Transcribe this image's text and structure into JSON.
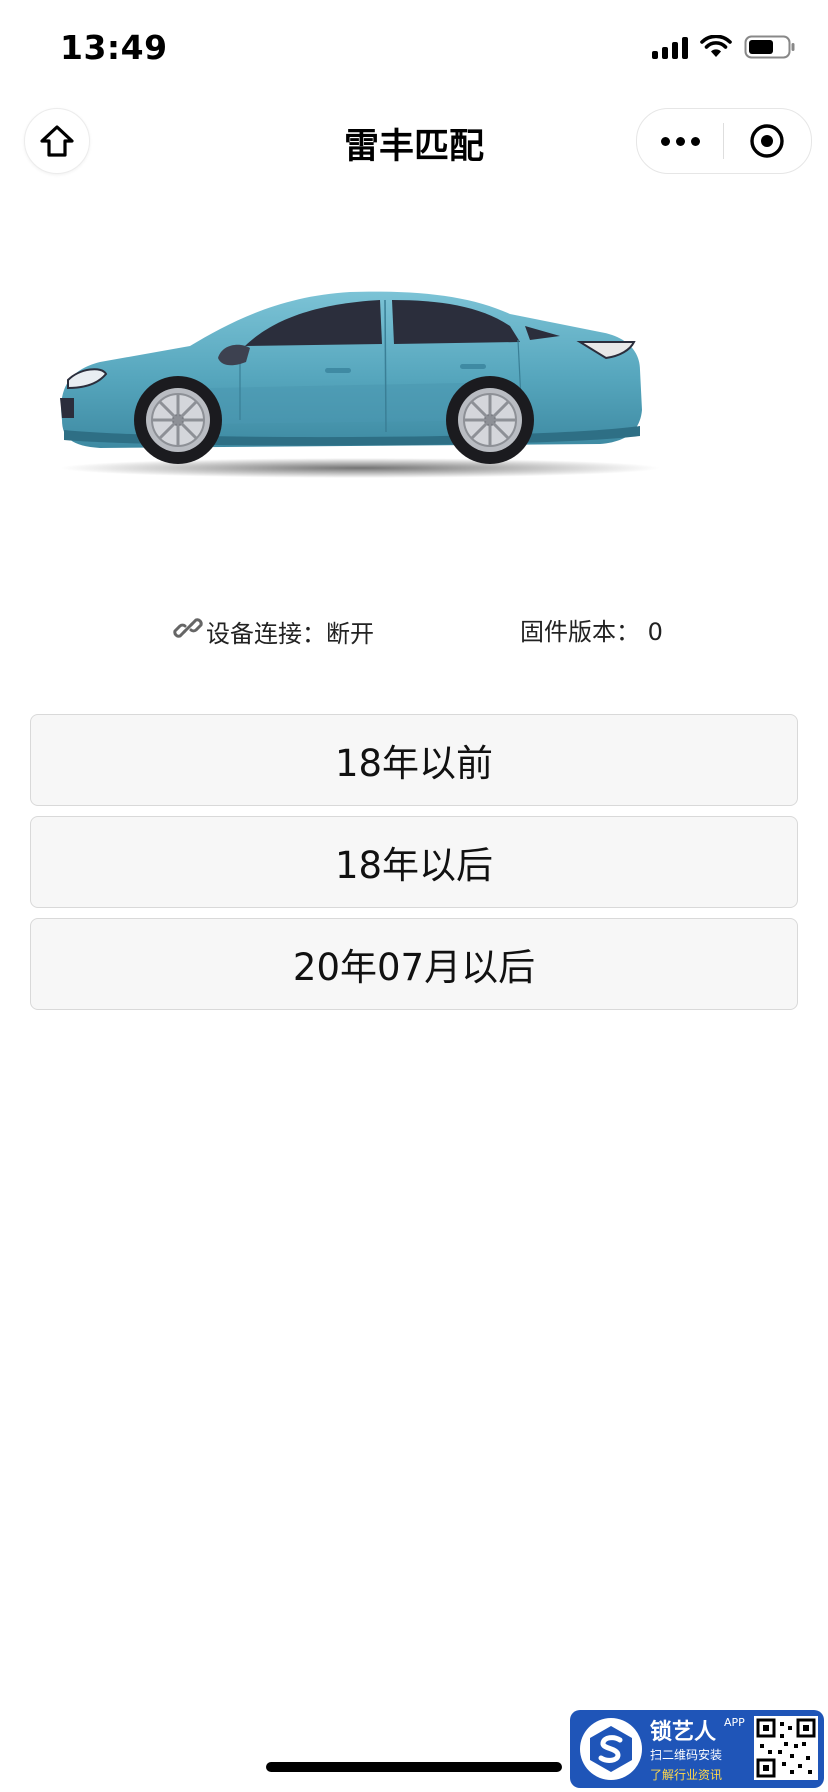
{
  "status_bar": {
    "time": "13:49"
  },
  "nav": {
    "title": "雷丰匹配"
  },
  "info": {
    "connection_label": "设备连接：",
    "connection_value": "断开",
    "firmware_label": "固件版本：",
    "firmware_value": "0"
  },
  "options": [
    {
      "label": "18年以前"
    },
    {
      "label": "18年以后"
    },
    {
      "label": "20年07月以后"
    }
  ],
  "watermark": {
    "name": "锁艺人",
    "badge": "APP",
    "line1": "扫二维码安装",
    "line2": "了解行业资讯"
  },
  "colors": {
    "car_body": "#5aa9c0",
    "button_bg": "#f7f7f7",
    "button_border": "#d9d9d9",
    "watermark_bg": "#1f55b8"
  },
  "icons": {
    "home": "home-icon",
    "more": "more-icon",
    "close": "target-circle-icon",
    "link": "link-icon"
  }
}
